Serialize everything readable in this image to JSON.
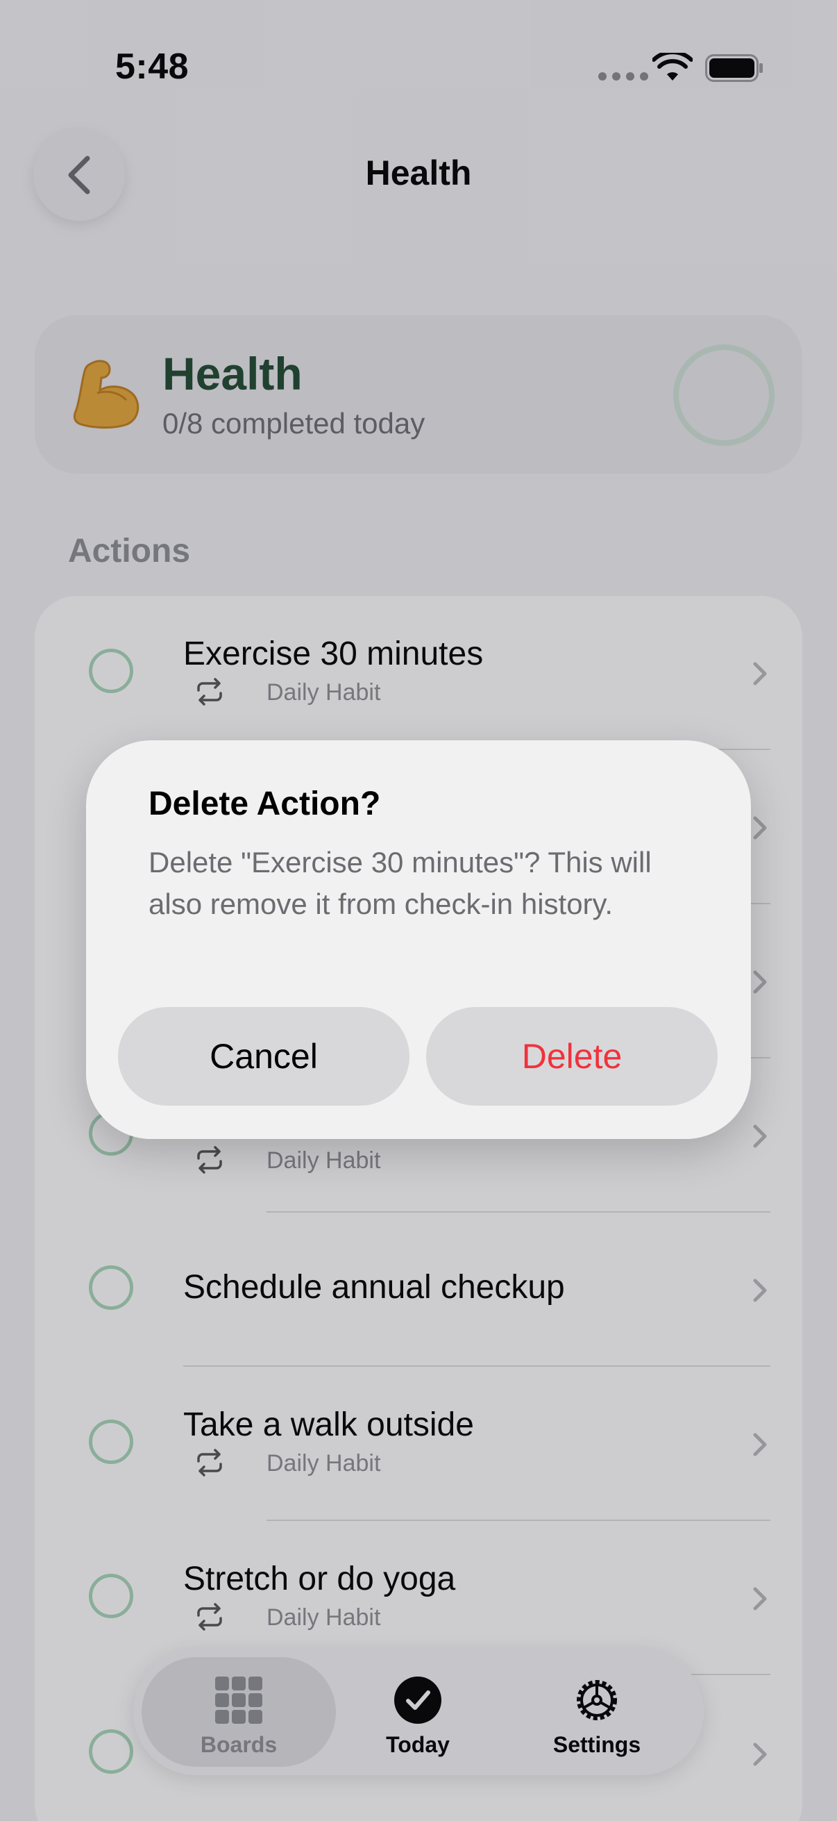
{
  "status_bar": {
    "time": "5:48"
  },
  "nav": {
    "title": "Health",
    "back_icon": "chevron-left-icon"
  },
  "header": {
    "emoji": "flexed-biceps",
    "title": "Health",
    "subtitle": "0/8 completed today",
    "progress": 0
  },
  "section": {
    "label": "Actions"
  },
  "actions": [
    {
      "title": "Exercise 30 minutes",
      "subtitle": "Daily Habit"
    },
    {
      "title": "",
      "subtitle": ""
    },
    {
      "title": "",
      "subtitle": ""
    },
    {
      "title": "",
      "subtitle": "Daily Habit"
    },
    {
      "title": "Schedule annual checkup",
      "subtitle": ""
    },
    {
      "title": "Take a walk outside",
      "subtitle": "Daily Habit"
    },
    {
      "title": "Stretch or do yoga",
      "subtitle": "Daily Habit"
    },
    {
      "title": "",
      "subtitle": ""
    }
  ],
  "tab_bar": {
    "tabs": [
      {
        "label": "Boards",
        "icon": "grid-icon",
        "selected": true
      },
      {
        "label": "Today",
        "icon": "checkmark-circle-icon",
        "selected": false
      },
      {
        "label": "Settings",
        "icon": "gear-icon",
        "selected": false
      }
    ]
  },
  "dialog": {
    "title": "Delete Action?",
    "message": "Delete \"Exercise 30 minutes\"? This will also remove it from check-in history.",
    "cancel_label": "Cancel",
    "delete_label": "Delete",
    "delete_color": "#f0323c"
  },
  "colors": {
    "accent_green": "#a8d7b8",
    "title_green": "#1e4a2e"
  }
}
